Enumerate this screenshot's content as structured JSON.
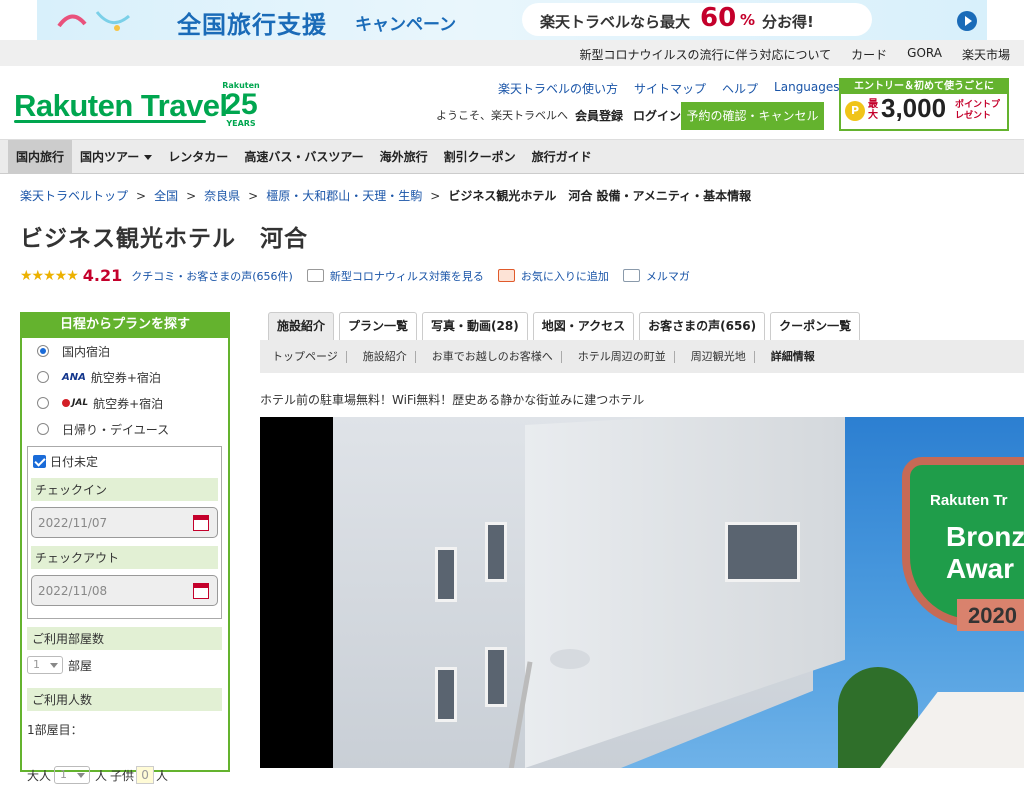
{
  "banner": {
    "title": "全国旅行支援",
    "subtitle": "キャンペーン",
    "pill_text": "楽天トラベルなら最大",
    "pill_percent": "60",
    "pill_pct_sign": "%",
    "pill_suffix": "分お得!"
  },
  "util_links": [
    "新型コロナウイルスの流行に伴う対応について",
    "カード",
    "GORA",
    "楽天市場"
  ],
  "header": {
    "logo": "Rakuten Travel",
    "years_top": "Rakuten",
    "years_num": "25",
    "years_bottom": "YEARS",
    "links": [
      "楽天トラベルの使い方",
      "サイトマップ",
      "ヘルプ",
      "Languages"
    ],
    "welcome": "ようこそ、楽天トラベルへ",
    "member": "会員登録",
    "login": "ログイン",
    "reserve": "予約の確認・キャンセル",
    "promo_top": "エントリー＆初めて使うごとに",
    "promo_coin": "P",
    "promo_max": "最大",
    "promo_num": "3,000",
    "promo_pt": "ポイントプレゼント"
  },
  "nav": [
    "国内旅行",
    "国内ツアー",
    "レンタカー",
    "高速バス・バスツアー",
    "海外旅行",
    "割引クーポン",
    "旅行ガイド"
  ],
  "breadcrumb": {
    "items": [
      "楽天トラベルトップ",
      "全国",
      "奈良県",
      "橿原・大和郡山・天理・生駒"
    ],
    "current": "ビジネス観光ホテル　河合 設備・アメニティ・基本情報",
    "sep": ">"
  },
  "hotel": {
    "name": "ビジネス観光ホテル　河合",
    "stars": "★★★★★",
    "score": "4.21",
    "reviews": "クチコミ・お客さまの声(656件)",
    "covid": "新型コロナウィルス対策を見る",
    "favorite": "お気に入りに追加",
    "mail": "メルマガ",
    "catch": "ホテル前の駐車場無料！WiFi無料！歴史ある静かな街並みに建つホテル"
  },
  "search": {
    "title": "日程からプランを探す",
    "options": [
      "国内宿泊",
      "航空券+宿泊",
      "航空券+宿泊",
      "日帰り・デイユース"
    ],
    "ana": "ANA",
    "jal": "JAL",
    "undecided": "日付未定",
    "checkin_label": "チェックイン",
    "checkin": "2022/11/07",
    "checkout_label": "チェックアウト",
    "checkout": "2022/11/08",
    "rooms_label": "ご利用部屋数",
    "rooms_value": "1",
    "rooms_unit": "部屋",
    "people_label": "ご利用人数",
    "room1": "1部屋目：",
    "adult": "大人",
    "adult_value": "1",
    "adult_unit": "人",
    "child": "子供",
    "child_value": "0",
    "child_unit": "人"
  },
  "tabs": [
    "施設紹介",
    "プラン一覧",
    "写真・動画(28)",
    "地図・アクセス",
    "お客さまの声(656)",
    "クーポン一覧"
  ],
  "subnav": [
    "トップページ",
    "施設紹介",
    "お車でお越しのお客様へ",
    "ホテル周辺の町並",
    "周辺観光地",
    "詳細情報"
  ],
  "award": {
    "line1": "Rakuten Tr",
    "line2": "Bronz",
    "line3": "Awar",
    "year": "2020"
  }
}
